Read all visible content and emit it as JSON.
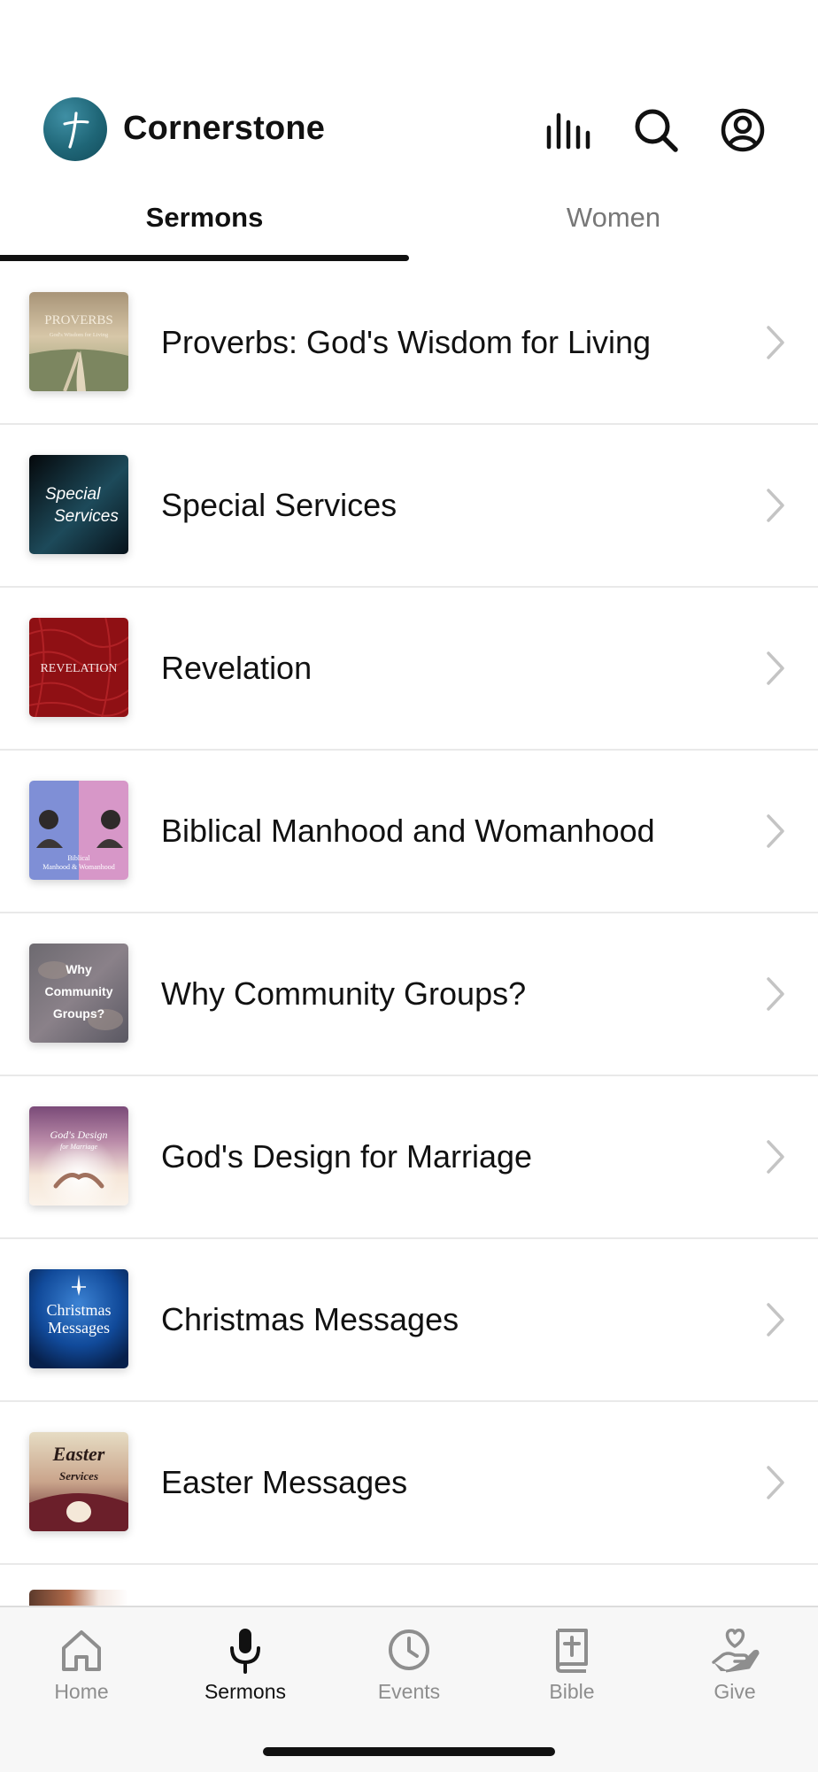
{
  "header": {
    "app_title": "Cornerstone"
  },
  "tabs": [
    {
      "label": "Sermons",
      "active": true
    },
    {
      "label": "Women",
      "active": false
    }
  ],
  "series": [
    {
      "title": "Proverbs: God's Wisdom for Living",
      "thumb_text": "PROVERBS",
      "thumb_sub": "God's Wisdom for Living"
    },
    {
      "title": "Special Services",
      "thumb_text": "Special",
      "thumb_sub": "Services"
    },
    {
      "title": "Revelation",
      "thumb_text": "REVELATION"
    },
    {
      "title": "Biblical Manhood and Womanhood",
      "thumb_text": "Biblical",
      "thumb_sub": "Manhood & Womanhood"
    },
    {
      "title": "Why Community Groups?",
      "thumb_text": "Why",
      "thumb_sub": "Community",
      "thumb_sub2": "Groups?"
    },
    {
      "title": "God's Design for Marriage",
      "thumb_text": "God's Design",
      "thumb_sub": "for Marriage"
    },
    {
      "title": "Christmas Messages",
      "thumb_text": "Christmas",
      "thumb_sub": "Messages"
    },
    {
      "title": "Easter Messages",
      "thumb_text": "Easter",
      "thumb_sub": "Services"
    }
  ],
  "bottom_nav": [
    {
      "label": "Home",
      "icon": "home-icon",
      "active": false
    },
    {
      "label": "Sermons",
      "icon": "microphone-icon",
      "active": true
    },
    {
      "label": "Events",
      "icon": "clock-icon",
      "active": false
    },
    {
      "label": "Bible",
      "icon": "bible-icon",
      "active": false
    },
    {
      "label": "Give",
      "icon": "give-hand-heart-icon",
      "active": false
    }
  ],
  "colors": {
    "accent": "#111111",
    "inactive": "#8e8e8e",
    "logo": "#1f6677"
  }
}
